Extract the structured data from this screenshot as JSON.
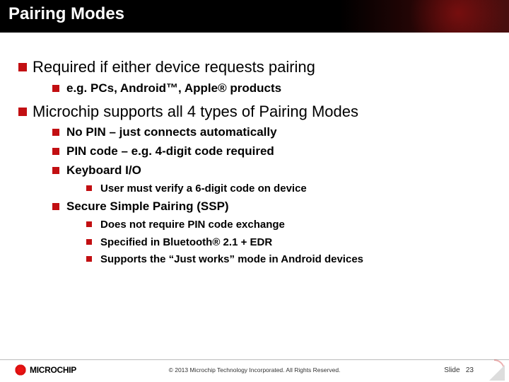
{
  "title": "Pairing Modes",
  "bullets": {
    "b1": "Required if either device requests pairing",
    "b1_1": "e.g. PCs, Android™, Apple® products",
    "b2": "Microchip supports all 4 types of Pairing Modes",
    "b2_1": "No PIN – just connects automatically",
    "b2_2": "PIN code – e.g. 4-digit code required",
    "b2_3": "Keyboard I/O",
    "b2_3_1": "User must verify a 6-digit code on device",
    "b2_4": "Secure Simple Pairing (SSP)",
    "b2_4_1": "Does not require PIN code exchange",
    "b2_4_2": "Specified in Bluetooth® 2.1 + EDR",
    "b2_4_3": "Supports the “Just works” mode in Android devices"
  },
  "footer": {
    "logo_text": "MICROCHIP",
    "copyright": "© 2013 Microchip Technology Incorporated. All Rights Reserved.",
    "page_label": "Slide",
    "page_num": "23"
  }
}
